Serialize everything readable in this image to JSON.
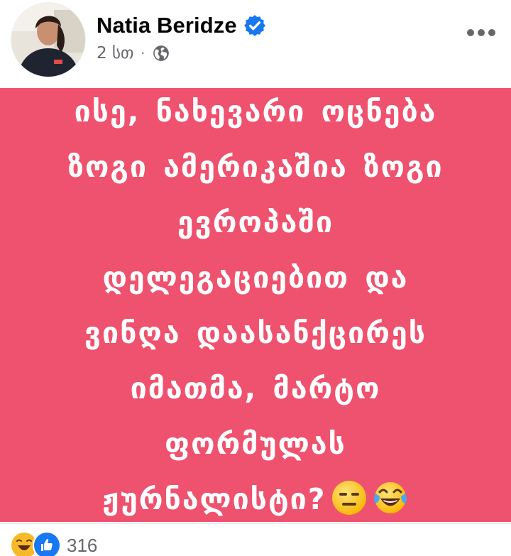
{
  "post": {
    "author_name": "Natia Beridze",
    "time": "2 სთ",
    "separator": "·",
    "privacy_icon": "globe-icon",
    "verified_icon": "verified-badge-icon",
    "more_icon": "more-horizontal-icon",
    "body_lines": [
      "ისე, ნახევარი ოცნება",
      "ზოგი ამერიკაშია ზოგი",
      "ევროპაში",
      "დელეგაციებით და",
      "ვინღა დაასანქცირეს",
      "იმათმა, მარტო",
      "ფორმულას",
      "ჟურნალისტი?"
    ],
    "body_emojis": [
      "expressionless-face-emoji",
      "tears-of-joy-emoji"
    ],
    "background_color": "#ef526e",
    "text_color": "#ffffff"
  },
  "reactions": {
    "icons": [
      "haha-reaction-icon",
      "like-reaction-icon"
    ],
    "count": "316"
  },
  "colors": {
    "accent_blue": "#1877f2",
    "meta_gray": "#65676b"
  }
}
